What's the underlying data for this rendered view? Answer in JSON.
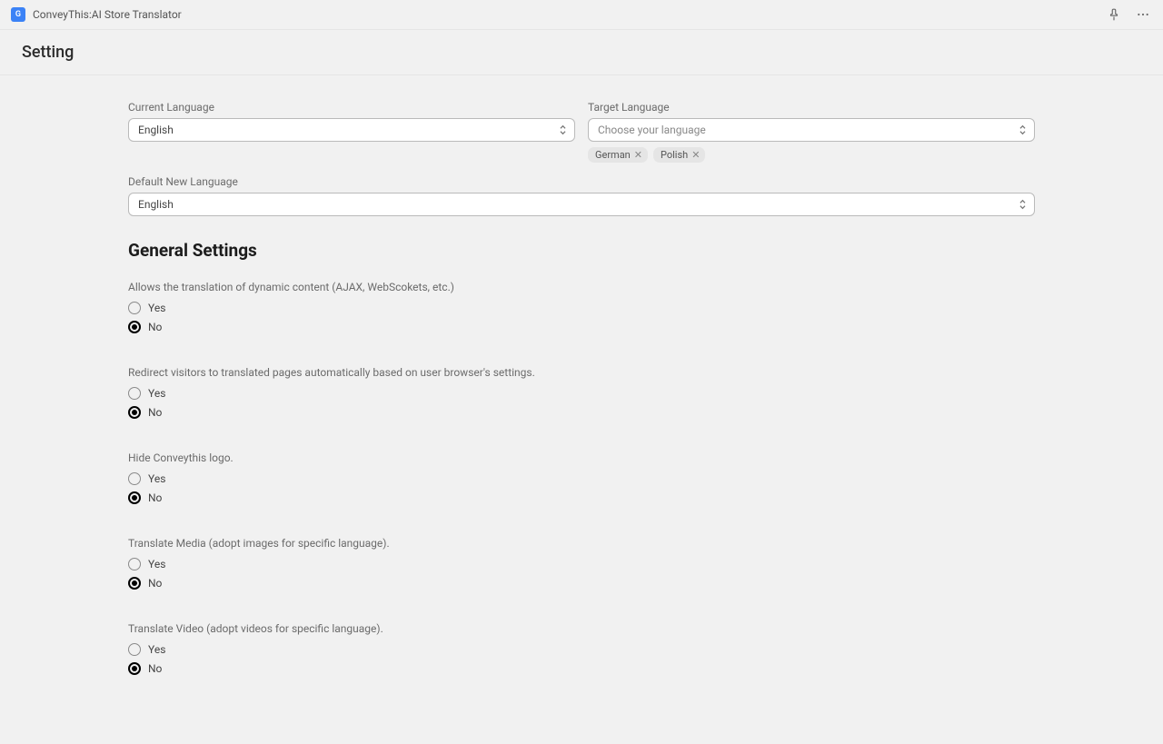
{
  "topbar": {
    "app_icon_letter": "G",
    "app_title": "ConveyThis:AI Store Translator"
  },
  "header": {
    "title": "Setting"
  },
  "fields": {
    "current_language": {
      "label": "Current Language",
      "value": "English"
    },
    "target_language": {
      "label": "Target Language",
      "placeholder": "Choose your language",
      "tags": [
        "German",
        "Polish"
      ]
    },
    "default_new_language": {
      "label": "Default New Language",
      "value": "English"
    }
  },
  "general": {
    "title": "General Settings",
    "items": [
      {
        "label": "Allows the translation of dynamic content (AJAX, WebScokets, etc.)",
        "options": [
          "Yes",
          "No"
        ],
        "selected": "No"
      },
      {
        "label": "Redirect visitors to translated pages automatically based on user browser's settings.",
        "options": [
          "Yes",
          "No"
        ],
        "selected": "No"
      },
      {
        "label": "Hide Conveythis logo.",
        "options": [
          "Yes",
          "No"
        ],
        "selected": "No"
      },
      {
        "label": "Translate Media (adopt images for specific language).",
        "options": [
          "Yes",
          "No"
        ],
        "selected": "No"
      },
      {
        "label": "Translate Video (adopt videos for specific language).",
        "options": [
          "Yes",
          "No"
        ],
        "selected": "No"
      }
    ]
  }
}
